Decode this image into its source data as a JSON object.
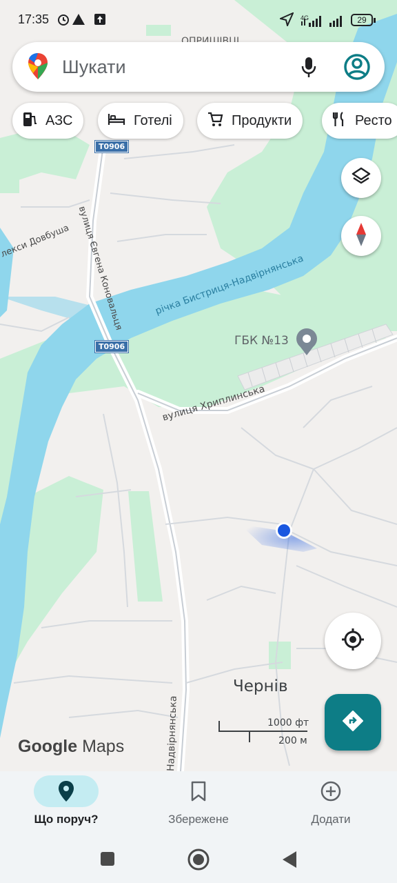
{
  "status_bar": {
    "time": "17:35",
    "network": "4G",
    "battery": "29"
  },
  "search": {
    "placeholder": "Шукати",
    "icons": [
      "google-maps-pin-icon",
      "microphone-icon",
      "account-icon"
    ]
  },
  "chips": [
    {
      "label": "АЗС",
      "icon": "gas-station-icon"
    },
    {
      "label": "Готелі",
      "icon": "bed-icon"
    },
    {
      "label": "Продукти",
      "icon": "cart-icon"
    },
    {
      "label": "Ресто",
      "icon": "restaurant-icon"
    }
  ],
  "map": {
    "labels": {
      "village_top": "ОПРИШІВЦІ",
      "road_koval": "вулиця Євгена Коновальця",
      "road_dovbush": "лекси Довбуша",
      "river": "річка Бистриця-Надвірнянська",
      "poi": "ГБК №13",
      "road_khryp": "вулиця Хриплинська",
      "road_nadv": "Надвірнянська",
      "town": "Чернів",
      "shield_1": "T0906",
      "shield_2": "T0906"
    },
    "scale": {
      "ft": "1000 фт",
      "m": "200 м"
    },
    "brand": {
      "google": "Google",
      "maps": "Maps"
    }
  },
  "nav": [
    {
      "label": "Що поруч?",
      "icon": "location-pin-icon",
      "active": true
    },
    {
      "label": "Збережене",
      "icon": "bookmark-icon",
      "active": false
    },
    {
      "label": "Додати",
      "icon": "add-circle-icon",
      "active": false
    }
  ],
  "colors": {
    "accent": "#0d7d86",
    "water": "#8fd6ec",
    "park": "#c9efd6",
    "land": "#f2f0ee",
    "location": "#1a57e0"
  }
}
